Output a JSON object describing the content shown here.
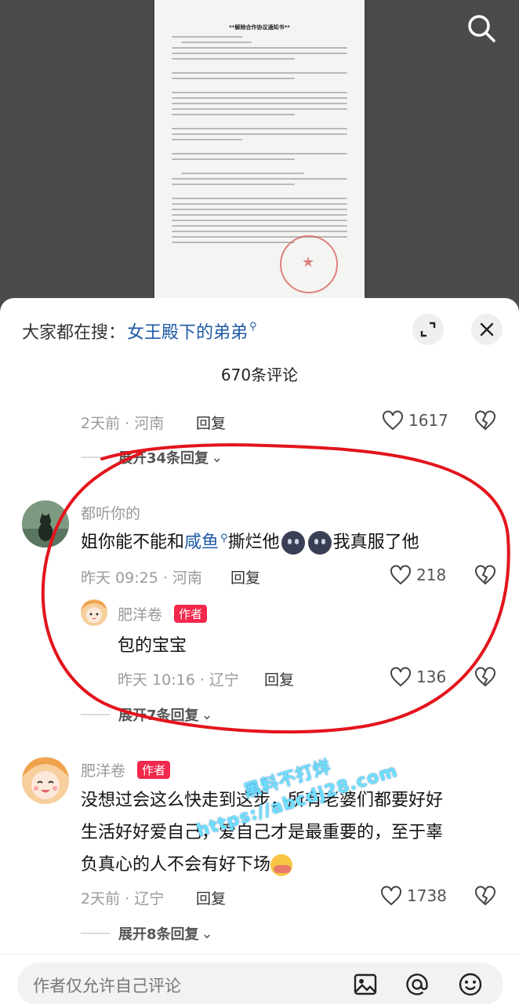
{
  "document": {
    "title": "**解除合作协议通知书**"
  },
  "sheet": {
    "search_prefix": "大家都在搜：",
    "search_term": "女王殿下的弟弟",
    "comment_count": "670条评论"
  },
  "comments": [
    {
      "meta": "2天前 · 河南",
      "reply_label": "回复",
      "likes": "1617",
      "expand_label": "展开34条回复"
    },
    {
      "username": "都听你的",
      "text_part1": "姐你能不能和",
      "text_link": "咸鱼",
      "text_part2": "撕烂他",
      "text_part3": "我真服了他",
      "meta": "昨天 09:25 · 河南",
      "reply_label": "回复",
      "likes": "218",
      "reply": {
        "username": "肥洋卷",
        "badge": "作者",
        "text": "包的宝宝",
        "meta": "昨天 10:16 · 辽宁",
        "reply_label": "回复",
        "likes": "136"
      },
      "expand_label": "展开7条回复"
    },
    {
      "username": "肥洋卷",
      "badge": "作者",
      "line1": "没想过会这么快走到这步，所有老婆们都要好好",
      "line2": "生活好好爱自己，爱自己才是最重要的，至于辜",
      "line3": "负真心的人不会有好下场",
      "meta": "2天前 · 辽宁",
      "reply_label": "回复",
      "likes": "1738",
      "expand_label": "展开8条回复"
    }
  ],
  "watermark": {
    "line1": "黑料不打烊",
    "line2": "https://abcdj28.com"
  },
  "bottom_bar": {
    "placeholder": "作者仅允许自己评论"
  },
  "icons": [
    "search-icon",
    "expand-icon",
    "close-icon",
    "heart-icon",
    "broken-heart-icon",
    "chevron-down-icon",
    "image-icon",
    "at-icon",
    "emoji-icon"
  ],
  "colors": {
    "accent_link": "#1f5aa6",
    "author_badge": "#f2284c",
    "annotation_red": "#e3141c"
  }
}
